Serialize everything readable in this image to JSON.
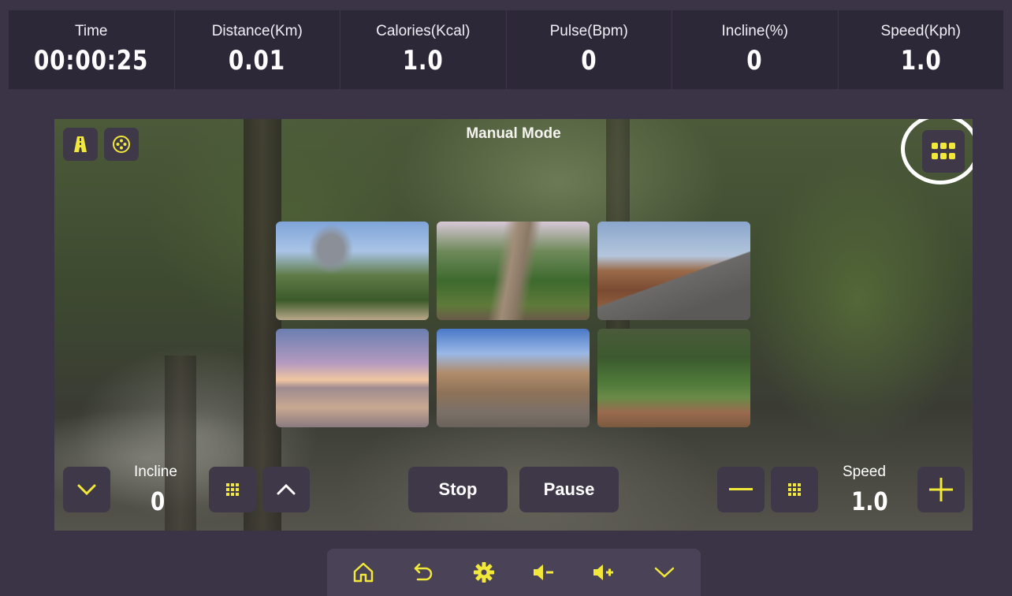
{
  "stats": [
    {
      "label": "Time",
      "value": "00:00:25"
    },
    {
      "label": "Distance(Km)",
      "value": "0.01"
    },
    {
      "label": "Calories(Kcal)",
      "value": "1.0"
    },
    {
      "label": "Pulse(Bpm)",
      "value": "0"
    },
    {
      "label": "Incline(%)",
      "value": "0"
    },
    {
      "label": "Speed(Kph)",
      "value": "1.0"
    }
  ],
  "scene": {
    "mode_title": "Manual Mode",
    "tool_icons": [
      "road-icon",
      "film-reel-icon"
    ],
    "grid_toggle_icon": "grid-icon",
    "thumbnails": [
      {
        "name": "granite-dome-trail"
      },
      {
        "name": "forest-dirt-road"
      },
      {
        "name": "coastal-highway"
      },
      {
        "name": "sunset-beach"
      },
      {
        "name": "desert-canyon"
      },
      {
        "name": "redwood-trail"
      }
    ]
  },
  "controls": {
    "incline_label": "Incline",
    "incline_value": "0",
    "stop_label": "Stop",
    "pause_label": "Pause",
    "speed_label": "Speed",
    "speed_value": "1.0"
  },
  "navbar": {
    "icons": [
      "home-icon",
      "back-icon",
      "settings-icon",
      "volume-down-icon",
      "volume-up-icon",
      "collapse-icon"
    ]
  },
  "colors": {
    "accent": "#f2e83a",
    "background": "#3b3346",
    "panel": "#2d2838",
    "button": "#3f3848"
  }
}
